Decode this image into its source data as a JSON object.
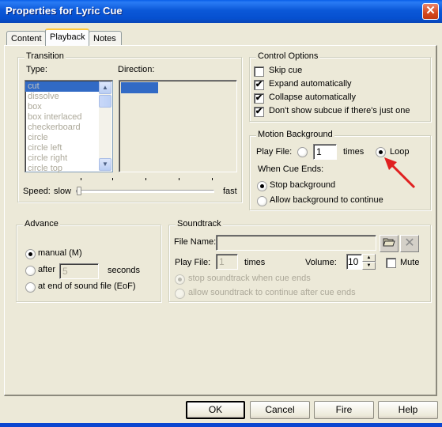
{
  "window": {
    "title": "Properties for Lyric Cue",
    "close_icon": "close-icon"
  },
  "tabs": [
    {
      "label": "Content",
      "active": false
    },
    {
      "label": "Playback",
      "active": true
    },
    {
      "label": "Notes",
      "active": false
    }
  ],
  "transition": {
    "title": "Transition",
    "type_label": "Type:",
    "direction_label": "Direction:",
    "types": [
      "cut",
      "dissolve",
      "box",
      "box interlaced",
      "checkerboard",
      "circle",
      "circle left",
      "circle right",
      "circle top"
    ],
    "selected_type": "cut",
    "speed_label": "Speed:",
    "speed_min_label": "slow",
    "speed_max_label": "fast",
    "speed_value": 0
  },
  "control_options": {
    "title": "Control Options",
    "items": [
      {
        "label": "Skip cue",
        "checked": false
      },
      {
        "label": "Expand automatically",
        "checked": true
      },
      {
        "label": "Collapse automatically",
        "checked": true
      },
      {
        "label": "Don't show subcue if there's just one",
        "checked": true
      }
    ]
  },
  "motion_background": {
    "title": "Motion Background",
    "play_file_label": "Play File:",
    "times_value": "1",
    "times_label": "times",
    "loop_label": "Loop",
    "play_mode": "loop",
    "when_ends_label": "When Cue Ends:",
    "options": [
      {
        "label": "Stop background",
        "checked": true
      },
      {
        "label": "Allow background to continue",
        "checked": false
      }
    ]
  },
  "advance": {
    "title": "Advance",
    "options": [
      {
        "label": "manual (M)",
        "checked": true
      },
      {
        "label": "after",
        "checked": false
      },
      {
        "label": "at end of sound file (EoF)",
        "checked": false
      }
    ],
    "seconds_value": "5",
    "seconds_label": "seconds"
  },
  "soundtrack": {
    "title": "Soundtrack",
    "file_name_label": "File Name:",
    "file_name_value": "",
    "play_file_label": "Play File:",
    "times_value": "1",
    "times_label": "times",
    "volume_label": "Volume:",
    "volume_value": "10",
    "mute_label": "Mute",
    "mute_checked": false,
    "options": [
      {
        "label": "stop soundtrack when cue ends",
        "checked": true
      },
      {
        "label": "allow soundtrack to continue after cue ends",
        "checked": false
      }
    ]
  },
  "buttons": {
    "ok": "OK",
    "cancel": "Cancel",
    "fire": "Fire",
    "help": "Help"
  },
  "annotation": {
    "arrow_color": "#e02020"
  }
}
